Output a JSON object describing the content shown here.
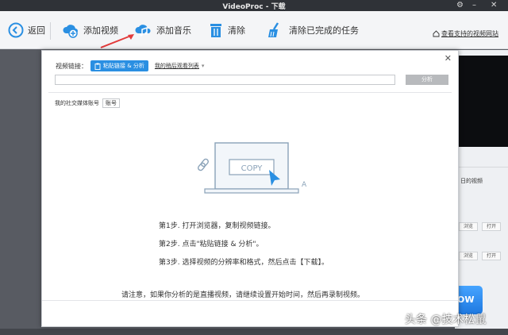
{
  "window": {
    "title": "VideoProc - 下载"
  },
  "toolbar": {
    "back_label": "返回",
    "add_video_label": "添加视频",
    "add_music_label": "添加音乐",
    "clear_label": "清除",
    "clear_done_label": "清除已完成的任务",
    "supported_sites_label": "查看支持的视频网站"
  },
  "dialog": {
    "video_link_label": "视频链接：",
    "paste_analyze_label": "粘贴链接 & 分析",
    "watch_later_label": "我的稍后观看列表",
    "url_value": "",
    "analyze_label": "分析",
    "social_label": "我的社交媒体账号",
    "account_label": "账号",
    "copy_text": "COPY",
    "steps": [
      "第1步. 打开浏览器，复制视频链接。",
      "第2步. 点击\"粘贴链接 & 分析\"。",
      "第3步. 选择视频的分辨率和格式，然后点击【下载】。"
    ],
    "notice": "请注意，如果你分析的是直播视频，请继续设置开始时间，然后再录制视频。"
  },
  "right_panel": {
    "text_1": "日的视频",
    "browse_label": "浏览",
    "open_label": "打开",
    "run_label": "OW"
  },
  "watermark": "头条 @技术松鼠",
  "colors": {
    "accent": "#2a8fe2",
    "arrow": "#e23b3b"
  }
}
